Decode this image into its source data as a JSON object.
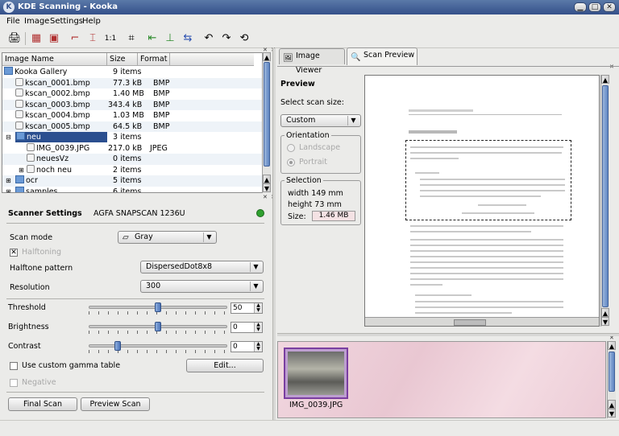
{
  "window": {
    "title": "KDE Scanning - Kooka",
    "controls": [
      "▁",
      "□",
      "✕"
    ]
  },
  "menu": [
    "File",
    "Image",
    "Settings",
    "Help"
  ],
  "toolbar": {
    "icons": [
      "scan-icon",
      "preview-icon",
      "save-icon",
      "crop-icon",
      "mirror-icon",
      "actual-size-icon",
      "scale-icon",
      "fit-width-icon",
      "fit-height-icon",
      "flip-icon",
      "rotate-left-icon",
      "rotate-right-icon",
      "rotate-180-icon"
    ]
  },
  "gallery": {
    "columns": [
      "Image Name",
      "Size",
      "Format"
    ],
    "rows": [
      {
        "name": "Kooka Gallery",
        "size": "9 items",
        "format": "",
        "type": "root"
      },
      {
        "name": "kscan_0001.bmp",
        "size": "77.3 kB",
        "format": "BMP",
        "type": "file"
      },
      {
        "name": "kscan_0002.bmp",
        "size": "1.40 MB",
        "format": "BMP",
        "type": "file"
      },
      {
        "name": "kscan_0003.bmp",
        "size": "343.4 kB",
        "format": "BMP",
        "type": "file"
      },
      {
        "name": "kscan_0004.bmp",
        "size": "1.03 MB",
        "format": "BMP",
        "type": "file"
      },
      {
        "name": "kscan_0005.bmp",
        "size": "64.5 kB",
        "format": "BMP",
        "type": "file"
      },
      {
        "name": "neu",
        "size": "3 items",
        "format": "",
        "type": "folder"
      },
      {
        "name": "IMG_0039.JPG",
        "size": "217.0 kB",
        "format": "JPEG",
        "type": "file"
      },
      {
        "name": "neuesVz",
        "size": "0 items",
        "format": "",
        "type": "subfolder"
      },
      {
        "name": "noch neu",
        "size": "2 items",
        "format": "",
        "type": "subfolder"
      },
      {
        "name": "ocr",
        "size": "5 items",
        "format": "",
        "type": "folder"
      },
      {
        "name": "samples",
        "size": "6 items",
        "format": "",
        "type": "folder"
      }
    ]
  },
  "scanner": {
    "title": "Scanner Settings",
    "device": "AGFA SNAPSCAN 1236U",
    "status_color": "#2fa02f",
    "scan_mode_label": "Scan mode",
    "scan_mode_value": "Gray",
    "halftoning_label": "Halftoning",
    "halftone_pattern_label": "Halftone pattern",
    "halftone_pattern_value": "DispersedDot8x8",
    "resolution_label": "Resolution",
    "resolution_value": "300",
    "threshold_label": "Threshold",
    "threshold_value": "50",
    "brightness_label": "Brightness",
    "brightness_value": "0",
    "contrast_label": "Contrast",
    "contrast_value": "0",
    "gamma_label": "Use custom gamma table",
    "edit_label": "Edit...",
    "negative_label": "Negative",
    "final_scan_label": "Final Scan",
    "preview_scan_label": "Preview Scan"
  },
  "tabs": [
    "Image Viewer",
    "Scan Preview"
  ],
  "preview": {
    "title": "Preview",
    "scan_size_label": "Select scan size:",
    "scan_size_value": "Custom",
    "orientation_label": "Orientation",
    "landscape_label": "Landscape",
    "portrait_label": "Portrait",
    "selection_label": "Selection",
    "width_text": "width 149 mm",
    "height_text": "height 73 mm",
    "size_label": "Size:",
    "size_value": "1.46 MB"
  },
  "thumbnail": {
    "caption": "IMG_0039.JPG"
  }
}
